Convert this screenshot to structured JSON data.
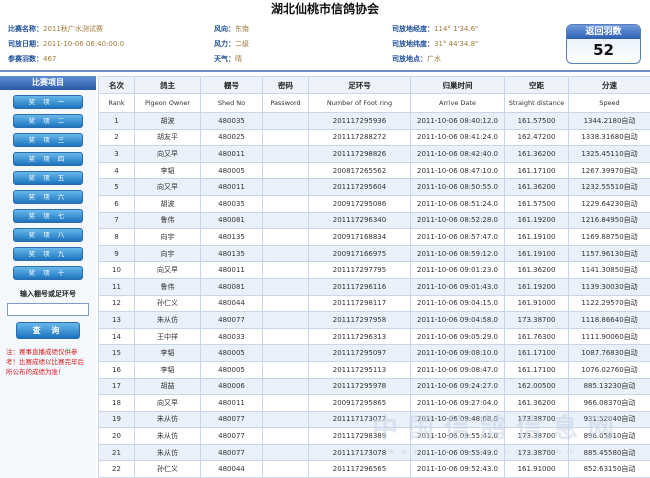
{
  "page": {
    "title": "湖北仙桃市信鸽协会"
  },
  "race_info": {
    "race_name_label": "比赛名称：",
    "race_name_value": "2011秋广水测试赛",
    "race_date_label": "司放日期：",
    "race_date_value": "2011-10-06 06:40:00.0",
    "entries_label": "参赛羽数：",
    "entries_value": "467",
    "wind_direction_label": "风向：",
    "wind_direction_value": "东南",
    "wind_force_label": "风力：",
    "wind_force_value": "二级",
    "weather_label": "天气：",
    "weather_value": "晴",
    "longitude_label": "司放地经度：",
    "longitude_value": "114° 1'34.6\"",
    "latitude_label": "司放地纬度：",
    "latitude_value": "31° 44'34.8\"",
    "location_label": "司放地点：",
    "location_value": "广水"
  },
  "return_badge": {
    "title": "返回羽数",
    "value": "52"
  },
  "sidebar": {
    "header": "比赛项目",
    "items": [
      {
        "label": "奖 项 一"
      },
      {
        "label": "奖 项 二"
      },
      {
        "label": "奖 项 三"
      },
      {
        "label": "奖 项 四"
      },
      {
        "label": "奖 项 五"
      },
      {
        "label": "奖 项 六"
      },
      {
        "label": "奖 项 七"
      },
      {
        "label": "奖 项 八"
      },
      {
        "label": "奖 项 九"
      },
      {
        "label": "奖 项 十"
      }
    ],
    "search_label": "输入棚号或足环号",
    "search_value": "",
    "query_button": "查 询",
    "notice": "注：赛事直播成绩仅供参考！比赛成绩以比赛完毕后所公布的成绩为准！"
  },
  "table": {
    "headers": [
      "名次",
      "鸽主",
      "棚号",
      "密码",
      "足环号",
      "归巢时间",
      "空距",
      "分速"
    ],
    "subheaders": [
      "Rank",
      "Pigeon Owner",
      "Shed No",
      "Password",
      "Number of Foot ring",
      "Arrive Date",
      "Straight distance",
      "Speed"
    ],
    "rows": [
      [
        "1",
        "胡波",
        "480035",
        "",
        "201117295936",
        "2011-10-06 08:40:12.0",
        "161.57500",
        "1344.2180自动"
      ],
      [
        "2",
        "胡友平",
        "480025",
        "",
        "201117288272",
        "2011-10-06 08:41:24.0",
        "162.47200",
        "1338.31680自动"
      ],
      [
        "3",
        "向又早",
        "480011",
        "",
        "201117298826",
        "2011-10-06 08:42:40.0",
        "161.36200",
        "1325.45110自动"
      ],
      [
        "4",
        "李韬",
        "480005",
        "",
        "200817265562",
        "2011-10-06 08:47:10.0",
        "161.17100",
        "1267.39970自动"
      ],
      [
        "5",
        "向又早",
        "480011",
        "",
        "201117295604",
        "2011-10-06 08:50:55.0",
        "161.36200",
        "1232.55510自动"
      ],
      [
        "6",
        "胡波",
        "480035",
        "",
        "200917295086",
        "2011-10-06 08:51:24.0",
        "161.57500",
        "1229.64230自动"
      ],
      [
        "7",
        "鲁伟",
        "480081",
        "",
        "201117296340",
        "2011-10-06 08:52:28.0",
        "161.19200",
        "1216.84950自动"
      ],
      [
        "8",
        "向宇",
        "480135",
        "",
        "200917168834",
        "2011-10-06 08:57:47.0",
        "161.19100",
        "1169.88750自动"
      ],
      [
        "9",
        "向宇",
        "480135",
        "",
        "200917166975",
        "2011-10-06 08:59:12.0",
        "161.19100",
        "1157.96130自动"
      ],
      [
        "10",
        "向又早",
        "480011",
        "",
        "201117297795",
        "2011-10-06 09:01:23.0",
        "161.36200",
        "1141.30850自动"
      ],
      [
        "11",
        "鲁伟",
        "480081",
        "",
        "201117296116",
        "2011-10-06 09:01:43.0",
        "161.19200",
        "1139.30030自动"
      ],
      [
        "12",
        "孙仁义",
        "480044",
        "",
        "201117298117",
        "2011-10-06 09:04:15.0",
        "161.91000",
        "1122.29570自动"
      ],
      [
        "13",
        "朱从仿",
        "480077",
        "",
        "201117297958",
        "2011-10-06 09:04:58.0",
        "173.38700",
        "1118.86640自动"
      ],
      [
        "14",
        "王中祥",
        "480033",
        "",
        "201117296313",
        "2011-10-06 09:05:29.0",
        "161.76300",
        "1111.90060自动"
      ],
      [
        "15",
        "李韬",
        "480005",
        "",
        "201117295097",
        "2011-10-06 09:08:10.0",
        "161.17100",
        "1087.76830自动"
      ],
      [
        "16",
        "李韬",
        "480005",
        "",
        "201117295113",
        "2011-10-06 09:08:47.0",
        "161.17100",
        "1076.02760自动"
      ],
      [
        "17",
        "胡喆",
        "480006",
        "",
        "201117295978",
        "2011-10-06 09:24:27.0",
        "162.00500",
        "885.13230自动"
      ],
      [
        "18",
        "向又早",
        "480011",
        "",
        "200917295865",
        "2011-10-06 09:27:04.0",
        "161.36200",
        "966.08370自动"
      ],
      [
        "19",
        "朱从仿",
        "480077",
        "",
        "201117173077",
        "2011-10-06 09:48:08.0",
        "173.38700",
        "931.52040自动"
      ],
      [
        "20",
        "朱从仿",
        "480077",
        "",
        "201117298389",
        "2011-10-06 09:55:41.0",
        "173.38700",
        "896.05810自动"
      ],
      [
        "21",
        "朱从仿",
        "480077",
        "",
        "201117173078",
        "2011-10-06 09:55:49.0",
        "173.38700",
        "885.45580自动"
      ],
      [
        "22",
        "孙仁义",
        "480044",
        "",
        "201117296565",
        "2011-10-06 09:52:43.0",
        "161.91000",
        "852.63150自动"
      ],
      [
        "23",
        "邵克斌",
        "480022",
        "",
        "201117296005",
        "2011-10-06 09:52:53.0",
        "161.40700",
        "836.61150自动"
      ]
    ]
  },
  "watermark": {
    "text": "中国信鸽信息网",
    "url": "www.chinaxinge.com"
  }
}
